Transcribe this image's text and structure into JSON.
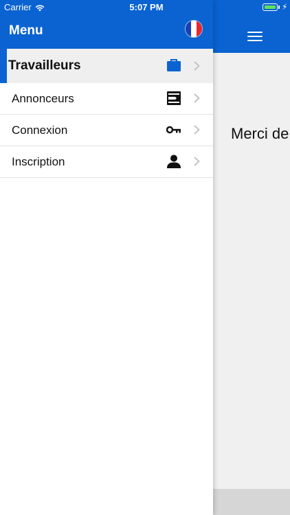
{
  "status_bar": {
    "carrier": "Carrier",
    "time": "5:07 PM",
    "battery_color": "#5ee35a"
  },
  "drawer": {
    "title": "Menu",
    "flag_icon": "france-flag-icon",
    "items": [
      {
        "label": "Travailleurs",
        "icon": "briefcase-icon",
        "active": true
      },
      {
        "label": "Annonceurs",
        "icon": "document-icon",
        "active": false
      },
      {
        "label": "Connexion",
        "icon": "key-icon",
        "active": false
      },
      {
        "label": "Inscription",
        "icon": "user-icon",
        "active": false
      }
    ]
  },
  "main": {
    "text": "Merci de",
    "menu_icon": "hamburger-icon"
  },
  "colors": {
    "brand_blue": "#0a63d0",
    "active_bg": "#efefef",
    "main_bg": "#f0f0f0"
  }
}
